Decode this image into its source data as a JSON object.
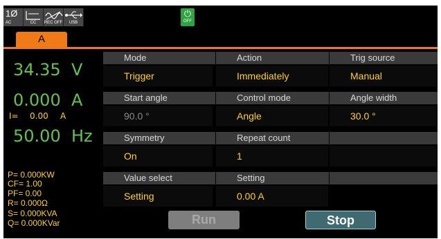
{
  "status_bar": {
    "items": [
      {
        "symbol": "1Ø",
        "label": "AC",
        "icon": "ac-phase-icon"
      },
      {
        "symbol": "",
        "label": "CC",
        "icon": "cc-mode-icon"
      },
      {
        "symbol": "",
        "label": "REC OFF",
        "icon": "waveform-rec-icon"
      },
      {
        "symbol": "",
        "label": "USB",
        "icon": "usb-icon"
      }
    ],
    "power_label": "OFF",
    "channel": "A",
    "colors": {
      "accent": "#f07a18",
      "power": "#2fa33f"
    }
  },
  "measurements": {
    "voltage": "34.35",
    "voltage_unit": "V",
    "current": "0.000",
    "current_unit": "A",
    "i_label": "I=",
    "i_value": "0.00",
    "i_unit": "A",
    "frequency": "50.00",
    "frequency_unit": "Hz",
    "p": "P=  0.000KW",
    "cf": "CF= 1.00",
    "pf": "PF= 0.00",
    "r": "R= 0.000Ω",
    "s": "S=  0.000KVA",
    "q": "Q=  0.000KVar"
  },
  "settings": {
    "mode_label": "Mode",
    "mode_value": "Trigger",
    "action_label": "Action",
    "action_value": "Immediately",
    "trig_source_label": "Trig source",
    "trig_source_value": "Manual",
    "start_angle_label": "Start angle",
    "start_angle_value": "90.0 °",
    "control_mode_label": "Control mode",
    "control_mode_value": "Angle",
    "angle_width_label": "Angle width",
    "angle_width_value": "30.0 °",
    "symmetry_label": "Symmetry",
    "symmetry_value": "On",
    "repeat_count_label": "Repeat count",
    "repeat_count_value": "1",
    "value_select_label": "Value select",
    "value_select_value": "Setting",
    "setting_label": "Setting",
    "setting_value": "0.00 A"
  },
  "buttons": {
    "run": "Run",
    "stop": "Stop"
  }
}
